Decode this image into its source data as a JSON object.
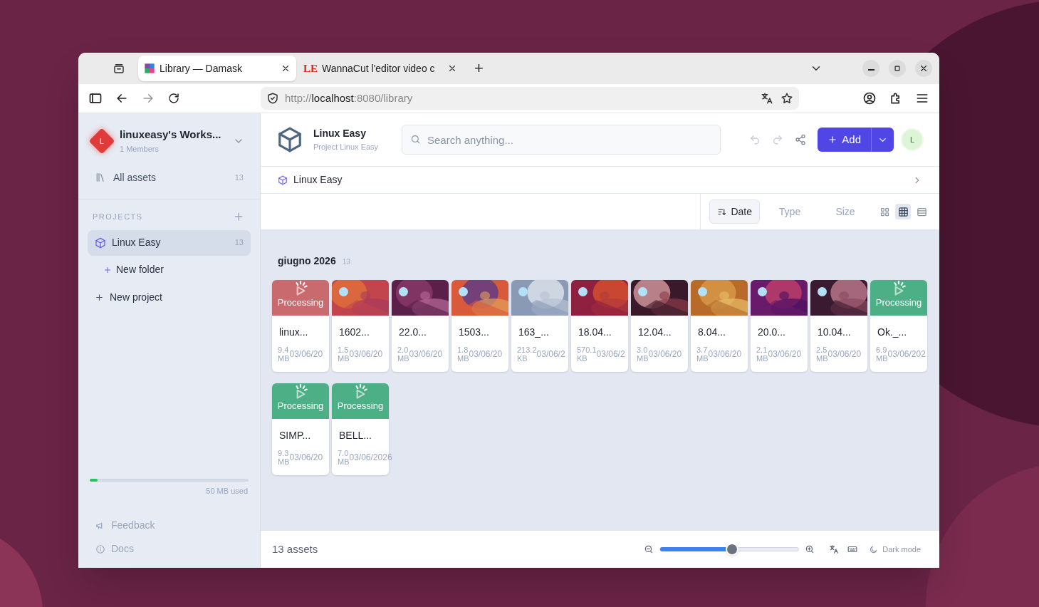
{
  "browser": {
    "tabs": [
      {
        "kind": "mosaic",
        "title": "Library — Damask",
        "selected": true
      },
      {
        "kind": "logo",
        "title": "WannaCut l'editor video c",
        "selected": false,
        "logo_text": "LE"
      }
    ],
    "new_tab": "+",
    "url": {
      "scheme": "http://",
      "host": "localhost",
      "rest": ":8080/library"
    }
  },
  "sidebar": {
    "workspace": {
      "avatar": "L",
      "name": "linuxeasy's Works...",
      "members": "1 Members"
    },
    "all_assets": {
      "label": "All assets",
      "count": "13"
    },
    "projects_heading": "PROJECTS",
    "projects": [
      {
        "label": "Linux Easy",
        "count": "13",
        "selected": true
      }
    ],
    "new_folder": "New folder",
    "new_project": "New project",
    "storage": {
      "level": 0.05,
      "label": "50 MB used"
    },
    "footer_links": [
      {
        "label": "Feedback",
        "kind": "feedback"
      },
      {
        "label": "Docs",
        "kind": "docs"
      }
    ]
  },
  "header": {
    "project": "Linux Easy",
    "subtitle": "Project Linux Easy",
    "search_placeholder": "Search anything...",
    "add": "Add",
    "avatar": "L"
  },
  "breadcrumb": "Linux Easy",
  "sort": [
    {
      "label": "Date",
      "selected": true
    },
    {
      "label": "Type",
      "selected": false
    },
    {
      "label": "Size",
      "selected": false
    }
  ],
  "views": [
    {
      "kind": "grid-small",
      "selected": false
    },
    {
      "kind": "grid",
      "selected": true
    },
    {
      "kind": "list",
      "selected": false
    }
  ],
  "group": {
    "title": "giugno 2026",
    "count": "13"
  },
  "assets": [
    {
      "kind": "processing",
      "color": "#c96a6e",
      "status": "Processing",
      "name": "linux...",
      "size": "9.4",
      "unit": "MB",
      "date": "03/06/20"
    },
    {
      "name": "1602...",
      "size": "1.5",
      "unit": "MB",
      "date": "03/06/20"
    },
    {
      "name": "22.0...",
      "size": "2.0",
      "unit": "MB",
      "date": "03/06/20"
    },
    {
      "name": "1503...",
      "size": "1.8",
      "unit": "MB",
      "date": "03/06/20"
    },
    {
      "name": "163_...",
      "size": "213.2",
      "unit": "KB",
      "date": "03/06/2"
    },
    {
      "name": "18.04...",
      "size": "570.1",
      "unit": "KB",
      "date": "03/06/2"
    },
    {
      "name": "12.04...",
      "size": "3.0",
      "unit": "MB",
      "date": "03/06/20"
    },
    {
      "name": "8.04...",
      "size": "3.7",
      "unit": "MB",
      "date": "03/06/20"
    },
    {
      "name": "20.0...",
      "size": "2.1",
      "unit": "MB",
      "date": "03/06/20"
    },
    {
      "name": "10.04...",
      "size": "2.5",
      "unit": "MB",
      "date": "03/06/20"
    },
    {
      "kind": "processing",
      "color": "#4caf86",
      "status": "Processing",
      "name": "Ok._...",
      "size": "6.9",
      "unit": "MB",
      "date": "03/06/202"
    },
    {
      "kind": "processing",
      "color": "#4caf86",
      "status": "Processing",
      "name": "SIMP...",
      "size": "9.3",
      "unit": "MB",
      "date": "03/06/20"
    },
    {
      "kind": "processing",
      "color": "#4caf86",
      "status": "Processing",
      "name": "BELL...",
      "size": "7.0",
      "unit": "MB",
      "date": "03/06/2026"
    }
  ],
  "footer": {
    "count": "13 assets",
    "zoom": {
      "level": 0.52
    },
    "dark_mode": "Dark mode"
  }
}
